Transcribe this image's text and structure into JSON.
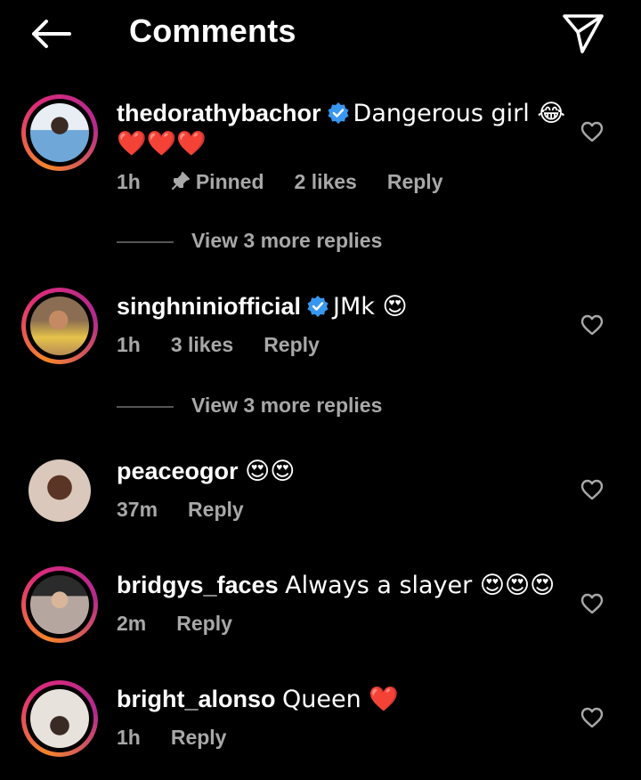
{
  "header": {
    "title": "Comments",
    "back_icon": "arrow-left-icon",
    "share_icon": "paper-plane-icon"
  },
  "colors": {
    "background": "#000000",
    "meta": "#a8a8a8",
    "verified": "#3897f0",
    "ring_from": "#f58529",
    "ring_to": "#dd2a7b"
  },
  "comments": [
    {
      "username": "thedorathybachor",
      "verified": true,
      "text": "Dangerous girl 😂",
      "text2": "❤️❤️❤️",
      "time": "1h",
      "pinned": "Pinned",
      "likes": "2 likes",
      "reply": "Reply"
    },
    {
      "username": "singhniniofficial",
      "verified": true,
      "text": "JMk 😍",
      "time": "1h",
      "likes": "3 likes",
      "reply": "Reply"
    },
    {
      "username": "peaceogor",
      "verified": false,
      "text": "😍😍",
      "time": "37m",
      "reply": "Reply"
    },
    {
      "username": "bridgys_faces",
      "verified": false,
      "text": "Always a slayer 😍😍😍",
      "time": "2m",
      "reply": "Reply"
    },
    {
      "username": "bright_alonso",
      "verified": false,
      "text": "Queen ❤️",
      "time": "1h",
      "reply": "Reply"
    }
  ],
  "view_more": [
    {
      "label": "View 3 more replies"
    },
    {
      "label": "View 3 more replies"
    }
  ]
}
